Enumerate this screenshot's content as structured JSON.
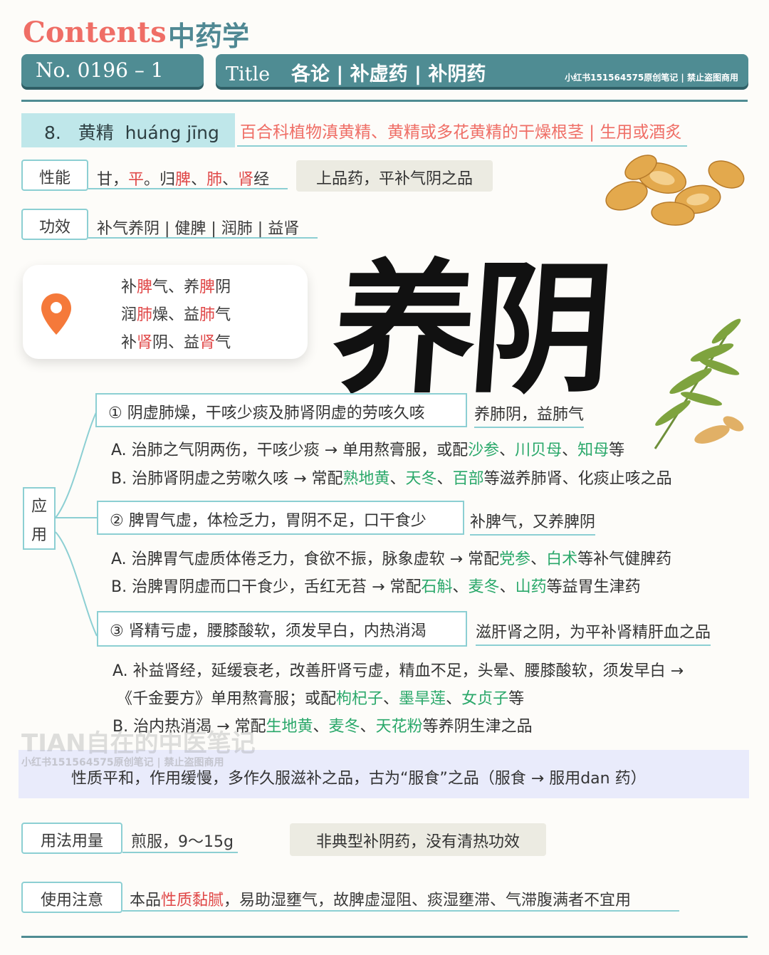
{
  "header": {
    "contents_label": "Contents",
    "subject": "中药学",
    "number": "No. 0196 – 1",
    "title_label": "Title",
    "title_path": "各论 | 补虚药 | 补阴药",
    "note": "小红书151564575原创笔记 | 禁止盗图商用"
  },
  "herb": {
    "index": "8.",
    "name": "黄精",
    "pinyin": "huáng jīng",
    "source": "百合科植物滇黄精、黄精或多花黄精的干燥根茎 | 生用或酒炙"
  },
  "property": {
    "label": "性能",
    "t1": "甘，",
    "t2": "平",
    "t3": "。归",
    "t4": "脾",
    "t5": "、",
    "t6": "肺",
    "t7": "、",
    "t8": "肾",
    "t9": "经",
    "tag": "上品药，平补气阴之品"
  },
  "effect": {
    "label": "功效",
    "text": "补气养阴 | 健脾 | 润肺 | 益肾"
  },
  "location": {
    "icon": "location-pin-icon",
    "l1": [
      "补",
      "脾",
      "气、养",
      "脾",
      "阴"
    ],
    "l2": [
      "润",
      "肺",
      "燥、益",
      "肺",
      "气"
    ],
    "l3": [
      "补",
      "肾",
      "阴、益",
      "肾",
      "气"
    ]
  },
  "calligraphy": "养阴",
  "application": {
    "label_1": "应",
    "label_2": "用",
    "c1": {
      "title": "① 阴虚肺燥，干咳少痰及肺肾阴虚的劳咳久咳",
      "note": "养肺阴，益肺气",
      "a": [
        "A. 治肺之气阴两伤，干咳少痰 → 单用熬膏服，或配",
        "沙参",
        "、",
        "川贝母",
        "、",
        "知母",
        "等"
      ],
      "b": [
        "B. 治肺肾阴虚之劳嗽久咳 → 常配",
        "熟地黄",
        "、",
        "天冬",
        "、",
        "百部",
        "等滋养肺肾、化痰止咳之品"
      ]
    },
    "c2": {
      "title": "② 脾胃气虚，体检乏力，胃阴不足，口干食少",
      "note": "补脾气，又养脾阴",
      "a": [
        "A. 治脾胃气虚质体倦乏力，食欲不振，脉象虚软 → 常配",
        "党参",
        "、",
        "白术",
        "等补气健脾药"
      ],
      "b": [
        "B. 治脾胃阴虚而口干食少，舌红无苔 → 常配",
        "石斛",
        "、",
        "麦冬",
        "、",
        "山药",
        "等益胃生津药"
      ]
    },
    "c3": {
      "title": "③ 肾精亏虚，腰膝酸软，须发早白，内热消渴",
      "note": "滋肝肾之阴，为平补肾精肝血之品",
      "a1": "A. 补益肾经，延缓衰老，改善肝肾亏虚，精血不足，头晕、腰膝酸软，须发早白 →",
      "a2": [
        "《千金要方》单用熬膏服；或配",
        "枸杞子",
        "、",
        "墨旱莲",
        "、",
        "女贞子",
        "等"
      ],
      "b": [
        "B. 治内热消渴 → 常配",
        "生地黄",
        "、",
        "麦冬",
        "、",
        "天花粉",
        "等养阴生津之品"
      ]
    }
  },
  "watermark": {
    "main": "TIAN自在的中医笔记",
    "sub": "小红书151564575原创笔记 | 禁止盗图商用"
  },
  "summary": "性质平和，作用缓慢，多作久服滋补之品，古为“服食”之品（服食 → 服用dan 药）",
  "usage": {
    "label": "用法用量",
    "text": "煎服，9～15g",
    "tag": "非典型补阴药，没有清热功效"
  },
  "caution": {
    "label": "使用注意",
    "t1": "本品",
    "t2": "性质黏腻",
    "t3": "，易助湿壅气，故脾虚湿阻、痰湿壅滞、气滞腹满者不宜用"
  },
  "colors": {
    "teal": "#4f8c93",
    "light_teal": "#8ccfd3",
    "red": "#e04848",
    "green": "#2aa86a",
    "coral": "#ef6e66"
  }
}
